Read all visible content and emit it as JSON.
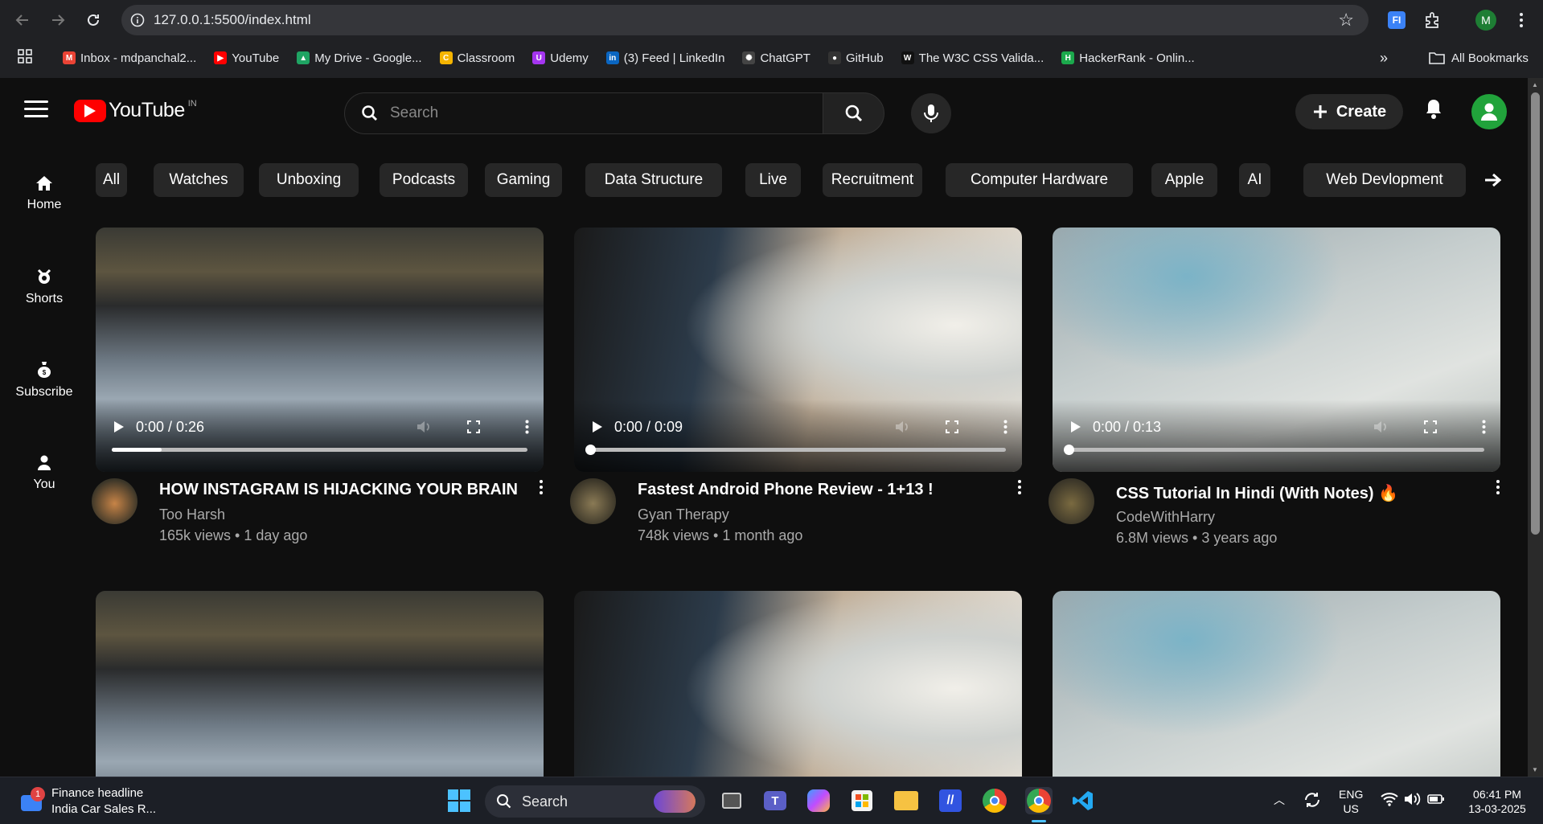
{
  "browser": {
    "url": "127.0.0.1:5500/index.html",
    "bookmarks": [
      {
        "label": "Inbox - mdpanchal2...",
        "icon": "gmail-icon",
        "color": "#ea4335"
      },
      {
        "label": "YouTube",
        "icon": "youtube-icon",
        "color": "#ff0000"
      },
      {
        "label": "My Drive - Google...",
        "icon": "drive-icon",
        "color": "#1fa463"
      },
      {
        "label": "Classroom",
        "icon": "classroom-icon",
        "color": "#f4b400"
      },
      {
        "label": "Udemy",
        "icon": "udemy-icon",
        "color": "#a435f0"
      },
      {
        "label": "(3) Feed | LinkedIn",
        "icon": "linkedin-icon",
        "color": "#0a66c2"
      },
      {
        "label": "ChatGPT",
        "icon": "chatgpt-icon",
        "color": "#444444"
      },
      {
        "label": "GitHub",
        "icon": "github-icon",
        "color": "#333333"
      },
      {
        "label": "The W3C CSS Valida...",
        "icon": "w3c-icon",
        "color": "#111111"
      },
      {
        "label": "HackerRank - Onlin...",
        "icon": "hackerrank-icon",
        "color": "#1ba94c"
      }
    ],
    "all_bookmarks_label": "All Bookmarks",
    "profile_initial": "M"
  },
  "youtube": {
    "logo_text": "YouTube",
    "country_code": "IN",
    "search_placeholder": "Search",
    "create_label": "Create",
    "sidebar": [
      {
        "label": "Home",
        "icon": "home-icon"
      },
      {
        "label": "Shorts",
        "icon": "shorts-icon"
      },
      {
        "label": "Subscribe",
        "icon": "subscriptions-icon"
      },
      {
        "label": "You",
        "icon": "user-icon"
      }
    ],
    "chips": [
      "All",
      "Watches",
      "Unboxing",
      "Podcasts",
      "Gaming",
      "Data Structure",
      "Live",
      "Recruitment",
      "Computer Hardware",
      "Apple",
      "AI",
      "Web Devlopment"
    ],
    "videos": [
      {
        "title": "HOW INSTAGRAM IS HIJACKING YOUR BRAIN",
        "channel": "Too Harsh",
        "stats": "165k views • 1 day ago",
        "time": "0:00 / 0:26",
        "progress": 0.12
      },
      {
        "title": "Fastest Android Phone Review - 1+13 !",
        "channel": "Gyan Therapy",
        "stats": "748k views • 1 month ago",
        "time": "0:00 / 0:09",
        "progress": 0.0
      },
      {
        "title": "CSS Tutorial In Hindi (With Notes) 🔥",
        "channel": "CodeWithHarry",
        "stats": "6.8M views • 3 years ago",
        "time": "0:00 / 0:13",
        "progress": 0.0
      }
    ]
  },
  "taskbar": {
    "news_title": "Finance headline",
    "news_sub": "India Car Sales R...",
    "news_badge": "1",
    "search_label": "Search",
    "lang_top": "ENG",
    "lang_bottom": "US",
    "time": "06:41 PM",
    "date": "13-03-2025"
  }
}
